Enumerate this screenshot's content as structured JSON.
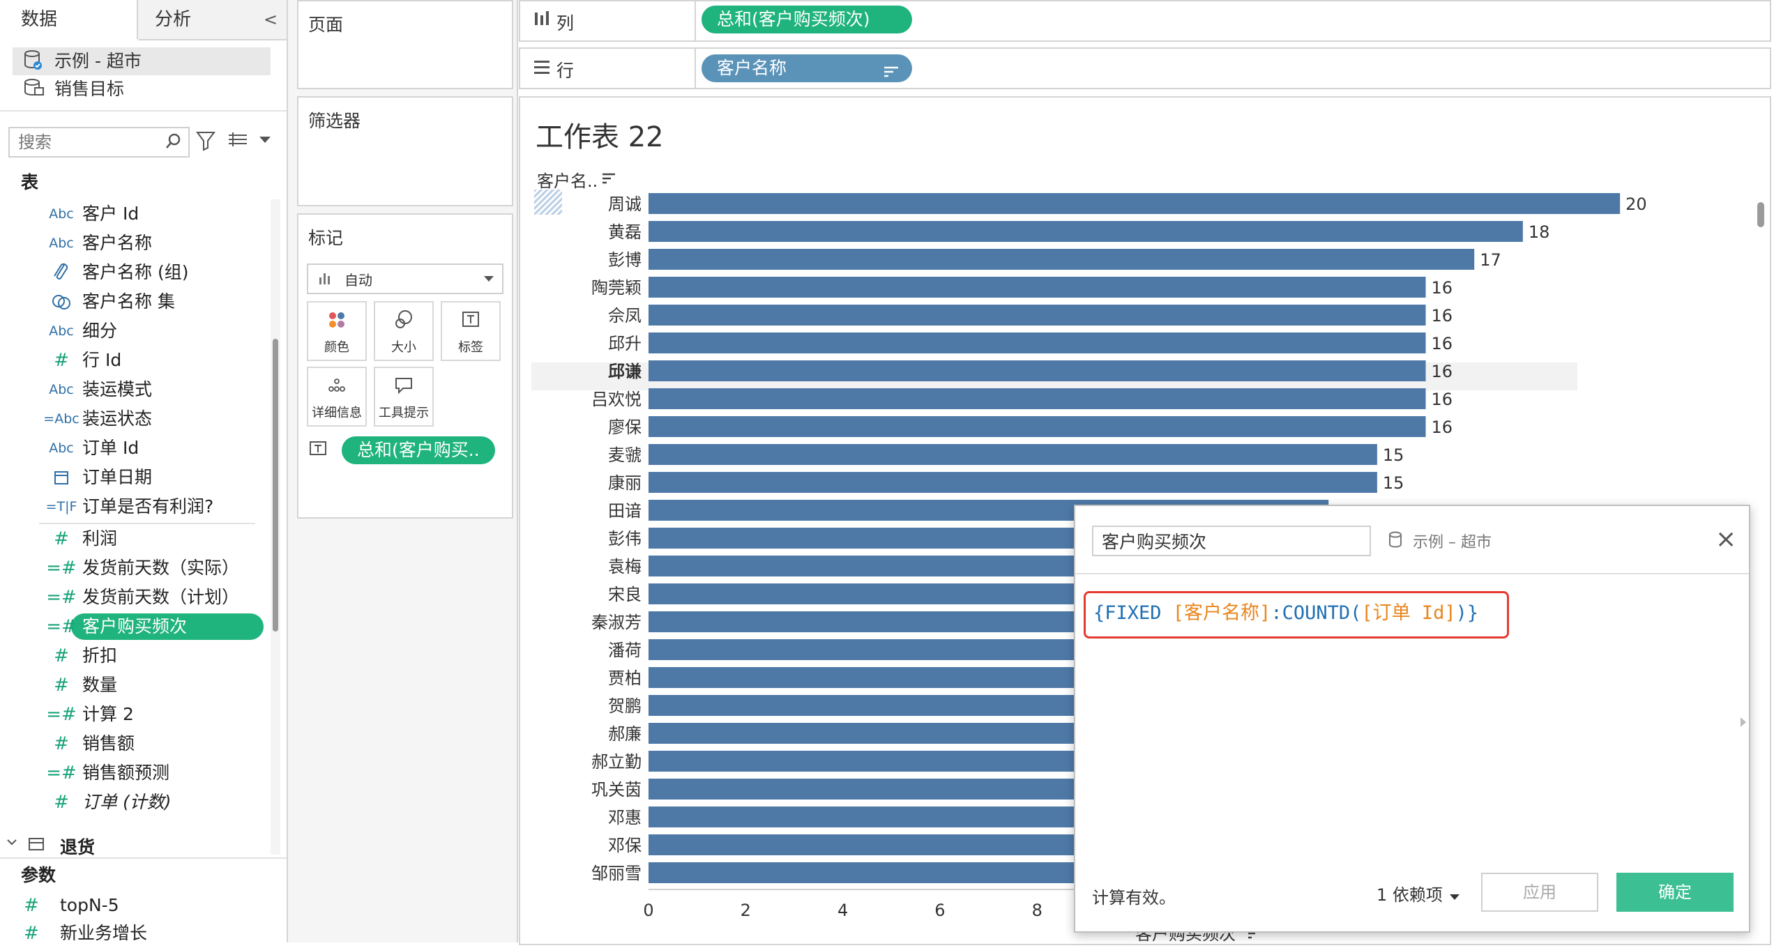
{
  "left_pane": {
    "tab_data": "数据",
    "tab_analysis": "分析",
    "collapse_glyph": "<",
    "sources": [
      "示例 - 超市",
      "销售目标"
    ],
    "search_placeholder": "搜索",
    "section_tables": "表",
    "fields": [
      {
        "type": "Abc",
        "name": "客户 Id"
      },
      {
        "type": "Abc",
        "name": "客户名称"
      },
      {
        "type": "clip",
        "name": "客户名称 (组)"
      },
      {
        "type": "set",
        "name": "客户名称 集"
      },
      {
        "type": "Abc",
        "name": "细分"
      },
      {
        "type": "#",
        "name": "行 Id"
      },
      {
        "type": "Abc",
        "name": "装运模式"
      },
      {
        "type": "=Abc",
        "name": "装运状态"
      },
      {
        "type": "Abc",
        "name": "订单 Id"
      },
      {
        "type": "date",
        "name": "订单日期"
      },
      {
        "type": "=T|F",
        "name": "订单是否有利润?"
      },
      {
        "type": "#",
        "name": "利润"
      },
      {
        "type": "=#",
        "name": "发货前天数（实际）"
      },
      {
        "type": "=#",
        "name": "发货前天数（计划）"
      },
      {
        "type": "=#",
        "name": "客户购买频次"
      },
      {
        "type": "#",
        "name": "折扣"
      },
      {
        "type": "#",
        "name": "数量"
      },
      {
        "type": "=#",
        "name": "计算 2"
      },
      {
        "type": "#",
        "name": "销售额"
      },
      {
        "type": "=#",
        "name": "销售额预测"
      },
      {
        "type": "#",
        "name": "订单 (计数)"
      }
    ],
    "returns_table": "退货",
    "section_params": "参数",
    "params": [
      "topN-5",
      "新业务增长"
    ]
  },
  "shelves": {
    "pages": "页面",
    "filters": "筛选器",
    "marks": "标记",
    "mark_type": "自动",
    "mark_buttons": [
      "颜色",
      "大小",
      "标签",
      "详细信息",
      "工具提示"
    ],
    "mark_pill": "总和(客户购买..",
    "columns_label": "列",
    "columns_pill": "总和(客户购买频次)",
    "rows_label": "行",
    "rows_pill": "客户名称"
  },
  "worksheet": {
    "title": "工作表 22",
    "row_header": "客户名..",
    "x_axis_title": "客户购买频次",
    "x_ticks": [
      "0",
      "2",
      "4",
      "6",
      "8"
    ]
  },
  "chart_data": {
    "type": "bar",
    "orientation": "horizontal",
    "categories": [
      "周诚",
      "黄磊",
      "彭博",
      "陶莞颖",
      "佘凤",
      "邱升",
      "邱谦",
      "吕欢悦",
      "廖保",
      "麦虢",
      "康丽",
      "田谙",
      "彭伟",
      "袁梅",
      "宋良",
      "秦淑芳",
      "潘荷",
      "贾柏",
      "贺鹏",
      "郝廉",
      "郝立勤",
      "巩关茵",
      "邓惠",
      "邓保",
      "邹丽雪"
    ],
    "values": [
      20,
      18,
      17,
      16,
      16,
      16,
      16,
      16,
      16,
      15,
      15,
      14,
      14,
      14,
      14,
      14,
      14,
      14,
      14,
      14,
      14,
      14,
      14,
      14,
      14
    ],
    "value_labels_visible": 11,
    "xlim": [
      0,
      20.5
    ],
    "xlabel": "客户购买频次",
    "ylabel": "客户名..",
    "color": "#4e79a7"
  },
  "dialog": {
    "name_value": "客户购买频次",
    "datasource": "示例 – 超市",
    "formula": {
      "p1": "{FIXED ",
      "p2": "[客户名称]",
      "p3": ":",
      "p4": "COUNTD",
      "p5": "(",
      "p6": "[订单 Id]",
      "p7": ")}"
    },
    "status": "计算有效。",
    "dependencies": "1 依赖项",
    "apply": "应用",
    "ok": "确定",
    "close": "×"
  },
  "colors": {
    "accent_green": "#1fb37e",
    "pill_blue": "#5b93b8",
    "bar_blue": "#4e79a7",
    "ok_button": "#3cbf93",
    "highlight_red": "#e53a2f"
  }
}
